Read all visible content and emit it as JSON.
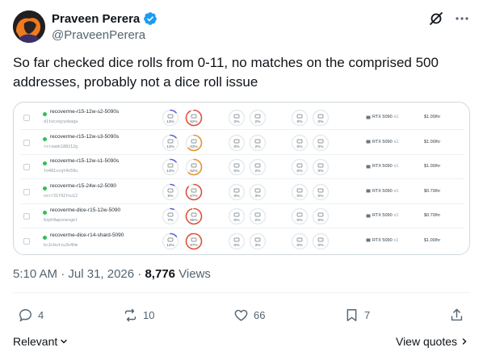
{
  "author": {
    "name": "Praveen Perera",
    "handle": "@PraveenPerera"
  },
  "tweet": {
    "text": "So far checked dice rolls from 0-11, no matches on the comprised 500 addresses, probably not a dice roll issue"
  },
  "table": {
    "rows": [
      {
        "name": "recoverme-r15-12w-s2-5090s",
        "id": "d1tocxqyyobaga",
        "cpu": "13%",
        "cpu_level": 0.13,
        "mem": "92%",
        "mem_level": 0.92,
        "disk1": "2%",
        "disk2": "2%",
        "net1": "0%",
        "net2": "0%",
        "gpu": "RTX 5090",
        "gpu_count": "x1",
        "price": "$1.00/hr"
      },
      {
        "name": "recoverme-r15-12w-s3-5090s",
        "id": "rsrzwek188212g",
        "cpu": "13%",
        "cpu_level": 0.13,
        "mem": "63%",
        "mem_level": 0.63,
        "disk1": "0%",
        "disk2": "2%",
        "net1": "0%",
        "net2": "0%",
        "gpu": "RTX 5090",
        "gpu_count": "x1",
        "price": "$1.00/hr"
      },
      {
        "name": "recoverme-r15-12w-s1-5090s",
        "id": "to481ssqt4o59u",
        "cpu": "13%",
        "cpu_level": 0.13,
        "mem": "62%",
        "mem_level": 0.62,
        "disk1": "0%",
        "disk2": "2%",
        "net1": "0%",
        "net2": "0%",
        "gpu": "RTX 5090",
        "gpu_count": "x1",
        "price": "$1.00/hr"
      },
      {
        "name": "recoverme-r15-24w-s2-5090",
        "id": "nxrr31f92fou12",
        "cpu": "8%",
        "cpu_level": 0.08,
        "mem": "87%",
        "mem_level": 0.87,
        "disk1": "0%",
        "disk2": "3%",
        "net1": "0%",
        "net2": "0%",
        "gpu": "RTX 5090",
        "gpu_count": "x1",
        "price": "$0.70/hr"
      },
      {
        "name": "recoverme-dice-r15-12w-5090",
        "id": "6zph9wpxnesgel",
        "cpu": "7%",
        "cpu_level": 0.07,
        "mem": "95%",
        "mem_level": 0.95,
        "disk1": "0%",
        "disk2": "2%",
        "net1": "0%",
        "net2": "0%",
        "gpu": "RTX 5090",
        "gpu_count": "x1",
        "price": "$0.70/hr"
      },
      {
        "name": "recoverme-dice-r14-shard-5090",
        "id": "kc2cbutvu3o4hm",
        "cpu": "14%",
        "cpu_level": 0.14,
        "mem": "97%",
        "mem_level": 0.97,
        "disk1": "0%",
        "disk2": "3%",
        "net1": "0%",
        "net2": "0%",
        "gpu": "RTX 5090",
        "gpu_count": "x1",
        "price": "$1.00/hr"
      }
    ]
  },
  "meta": {
    "time": "5:10 AM",
    "separator1": "·",
    "date": "Jul 31, 2026",
    "separator2": "·",
    "views_count": "8,776",
    "views_label": "Views"
  },
  "actions": {
    "replies": "4",
    "reposts": "10",
    "likes": "66",
    "bookmarks": "7"
  },
  "footer": {
    "relevant_label": "Relevant",
    "view_quotes_label": "View quotes"
  },
  "colors": {
    "accent": "#1d9bf0",
    "ring_low": "#5b5fd6",
    "ring_high": "#e0523c",
    "ring_mid": "#e2962c",
    "status_running": "#2fbf58"
  }
}
